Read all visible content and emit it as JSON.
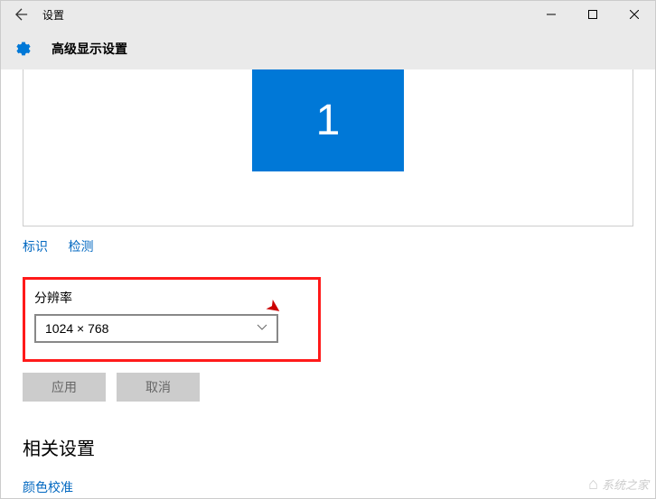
{
  "titlebar": {
    "title": "设置"
  },
  "header": {
    "title": "高级显示设置"
  },
  "display": {
    "monitor_number": "1"
  },
  "links": {
    "identify": "标识",
    "detect": "检测"
  },
  "resolution": {
    "label": "分辨率",
    "value": "1024 × 768"
  },
  "buttons": {
    "apply": "应用",
    "cancel": "取消"
  },
  "related": {
    "heading": "相关设置",
    "color_calibration": "颜色校准"
  },
  "watermark": {
    "text": "系统之家"
  }
}
